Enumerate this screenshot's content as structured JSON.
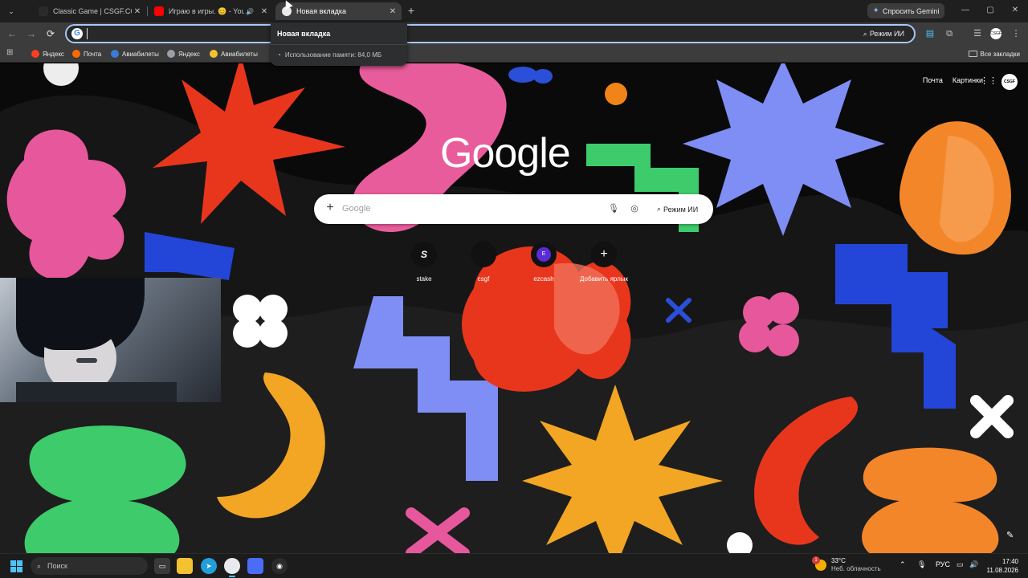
{
  "tabs": [
    {
      "title": "Classic Game | CSGF.CC",
      "favicon_color": "#1f1f1f",
      "active": false
    },
    {
      "title": "Играю в игры. 😊 - YouTube",
      "favicon_color": "#ff0000",
      "active": false
    },
    {
      "title": "Новая вкладка",
      "favicon_color": "#e8eaed",
      "active": true
    }
  ],
  "tab_controls": {
    "search_icon": "chevron-down",
    "close_icon": "✕",
    "audio_icon": "🔊",
    "new_tab_icon": "+"
  },
  "gemini_button": {
    "label": "Спросить Gemini"
  },
  "window_controls": {
    "minimize": "—",
    "maximize": "▢",
    "close": "✕"
  },
  "omnibox": {
    "value": "",
    "ai_mode_label": "Режим ИИ"
  },
  "hover_card": {
    "title": "Новая вкладка",
    "memory": "Использование памяти: 84,0 МБ"
  },
  "bookmarks": [
    {
      "label": "Яндекс",
      "color": "#fc3f1d"
    },
    {
      "label": "Почта",
      "color": "#ff6a00"
    },
    {
      "label": "Авиабилеты",
      "color": "#3a7bd5"
    },
    {
      "label": "Яндекс",
      "color": "#9aa0a6"
    },
    {
      "label": "Авиабилеты",
      "color": "#f2c230"
    }
  ],
  "all_bookmarks": "Все закладки",
  "ntp": {
    "header_links": [
      "Почта",
      "Картинки"
    ],
    "avatar_text": "CSGF",
    "logo": "Google",
    "search_placeholder": "Google",
    "ai_mode_label": "Режим ИИ",
    "shortcuts": [
      {
        "label": "stake",
        "glyph": "S"
      },
      {
        "label": "csgf",
        "glyph": ""
      },
      {
        "label": "ezcash",
        "glyph": "E"
      },
      {
        "label": "Добавить ярлык",
        "glyph": "+"
      }
    ]
  },
  "taskbar": {
    "search_label": "Поиск",
    "weather": {
      "temp": "33°C",
      "desc": "Неб. облачность",
      "badge": "1"
    },
    "lang": "РУС",
    "time": "17:40",
    "date": "11.08.2026"
  },
  "colors": {
    "accent": "#a8c7fa",
    "taskbar_accent": "#4cc2ff"
  }
}
